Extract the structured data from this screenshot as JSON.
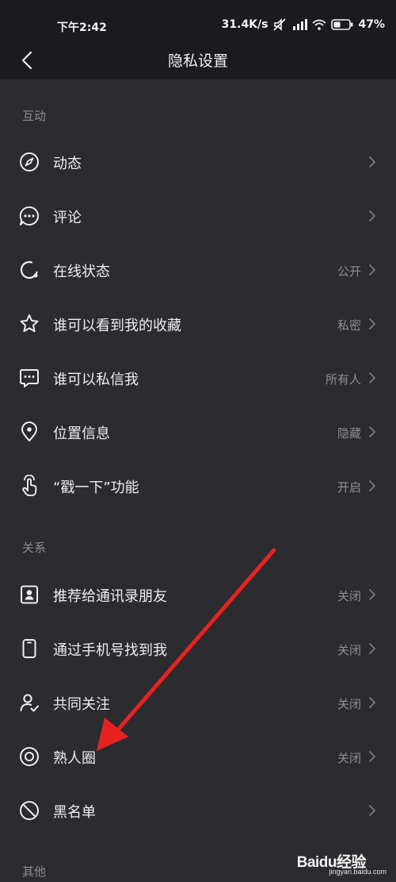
{
  "status": {
    "time": "下午2:42",
    "net_speed": "31.4K/s",
    "battery": "47%"
  },
  "nav": {
    "title": "隐私设置"
  },
  "sections": {
    "interaction": "互动",
    "relation": "关系",
    "other": "其他"
  },
  "items": {
    "moments": {
      "label": "动态",
      "value": "",
      "icon": "compass-icon"
    },
    "comments": {
      "label": "评论",
      "value": "",
      "icon": "comment-bubble-icon"
    },
    "online_status": {
      "label": "在线状态",
      "value": "公开",
      "icon": "online-status-icon"
    },
    "favorites": {
      "label": "谁可以看到我的收藏",
      "value": "私密",
      "icon": "star-icon"
    },
    "direct_message": {
      "label": "谁可以私信我",
      "value": "所有人",
      "icon": "message-icon"
    },
    "location": {
      "label": "位置信息",
      "value": "隐藏",
      "icon": "location-pin-icon"
    },
    "poke": {
      "label": "“戳一下”功能",
      "value": "开启",
      "icon": "tap-finger-icon"
    },
    "contacts_recommend": {
      "label": "推荐给通讯录朋友",
      "value": "关闭",
      "icon": "contact-card-icon"
    },
    "phone_find": {
      "label": "通过手机号找到我",
      "value": "关闭",
      "icon": "phone-icon"
    },
    "mutual_follow": {
      "label": "共同关注",
      "value": "关闭",
      "icon": "user-check-icon"
    },
    "acquaintance": {
      "label": "熟人圈",
      "value": "关闭",
      "icon": "circle-target-icon"
    },
    "blacklist": {
      "label": "黑名单",
      "value": "",
      "icon": "block-icon"
    }
  },
  "annotation": {
    "color": "#e8231f"
  },
  "watermark": {
    "main": "Baidu经验",
    "sub": "jingyan.baidu.com"
  }
}
